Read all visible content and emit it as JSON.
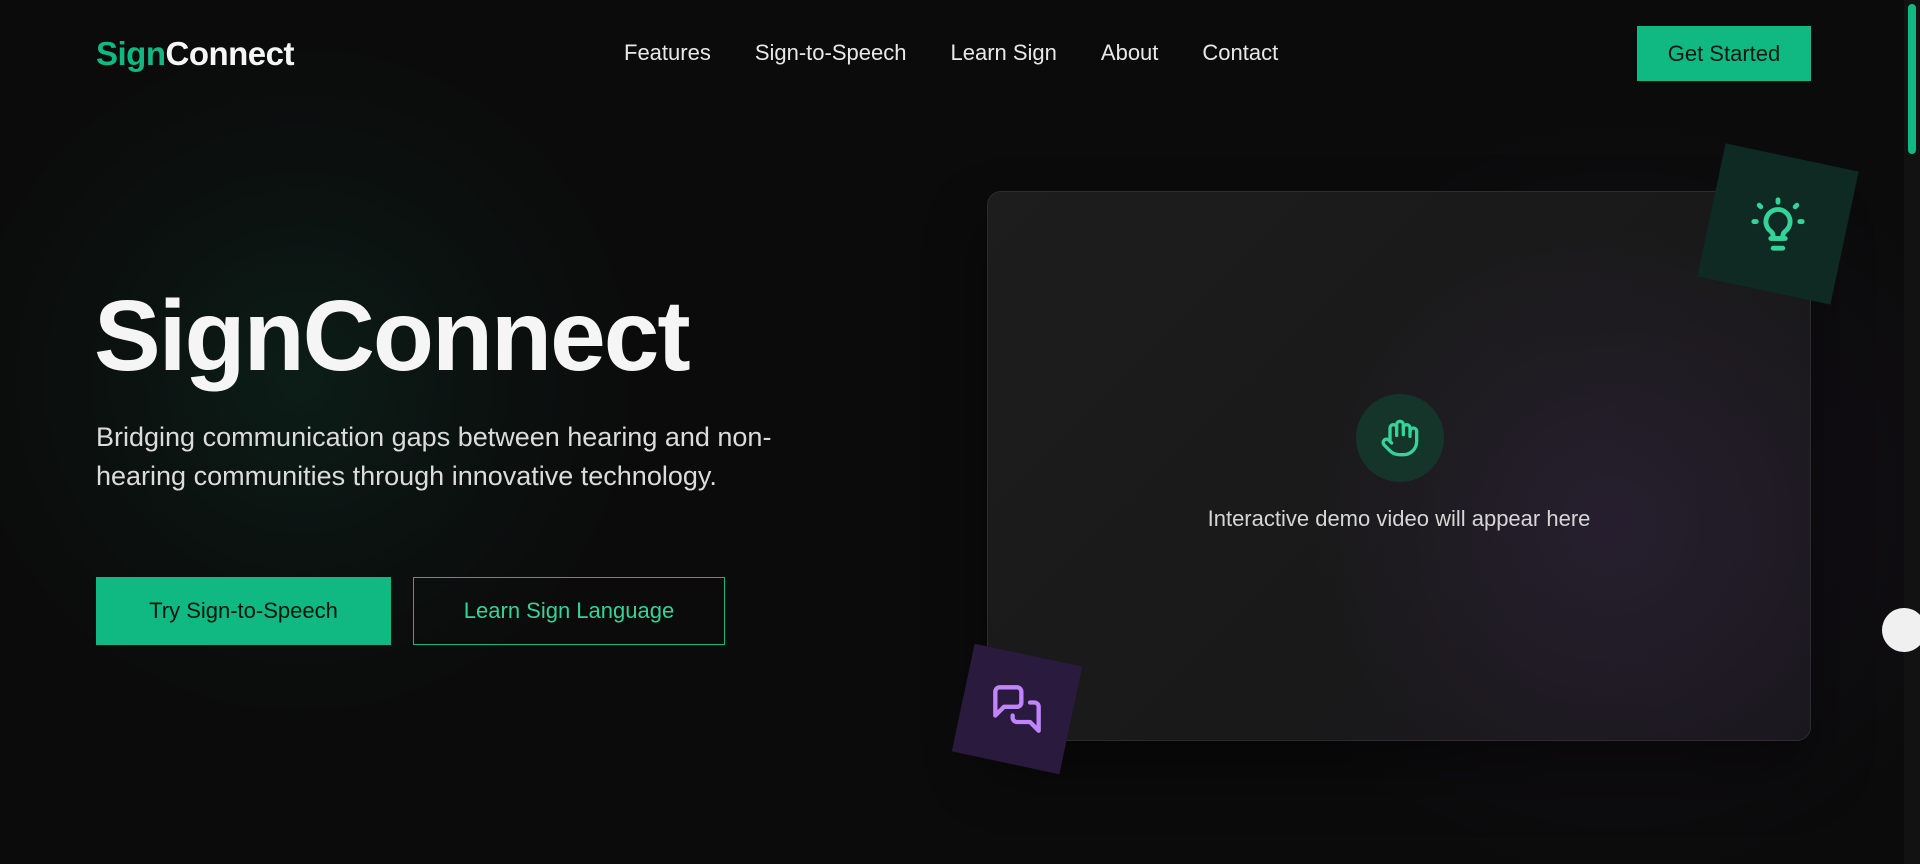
{
  "nav": {
    "logo_accent": "Sign",
    "logo_rest": "Connect",
    "links": [
      "Features",
      "Sign-to-Speech",
      "Learn Sign",
      "About",
      "Contact"
    ],
    "cta": "Get Started"
  },
  "hero": {
    "title": "SignConnect",
    "subtitle": "Bridging communication gaps between hearing and non-hearing communities through innovative technology.",
    "primary_button": "Try Sign-to-Speech",
    "secondary_button": "Learn Sign Language"
  },
  "demo": {
    "caption": "Interactive demo video will appear here",
    "icon": "hand-icon"
  },
  "decor": {
    "top_tile_icon": "lightbulb-icon",
    "bottom_tile_icon": "chat-bubbles-icon"
  },
  "colors": {
    "accent": "#10b981",
    "accent_light": "#34d399",
    "purple": "#c084fc",
    "background": "#0b0b0b"
  }
}
